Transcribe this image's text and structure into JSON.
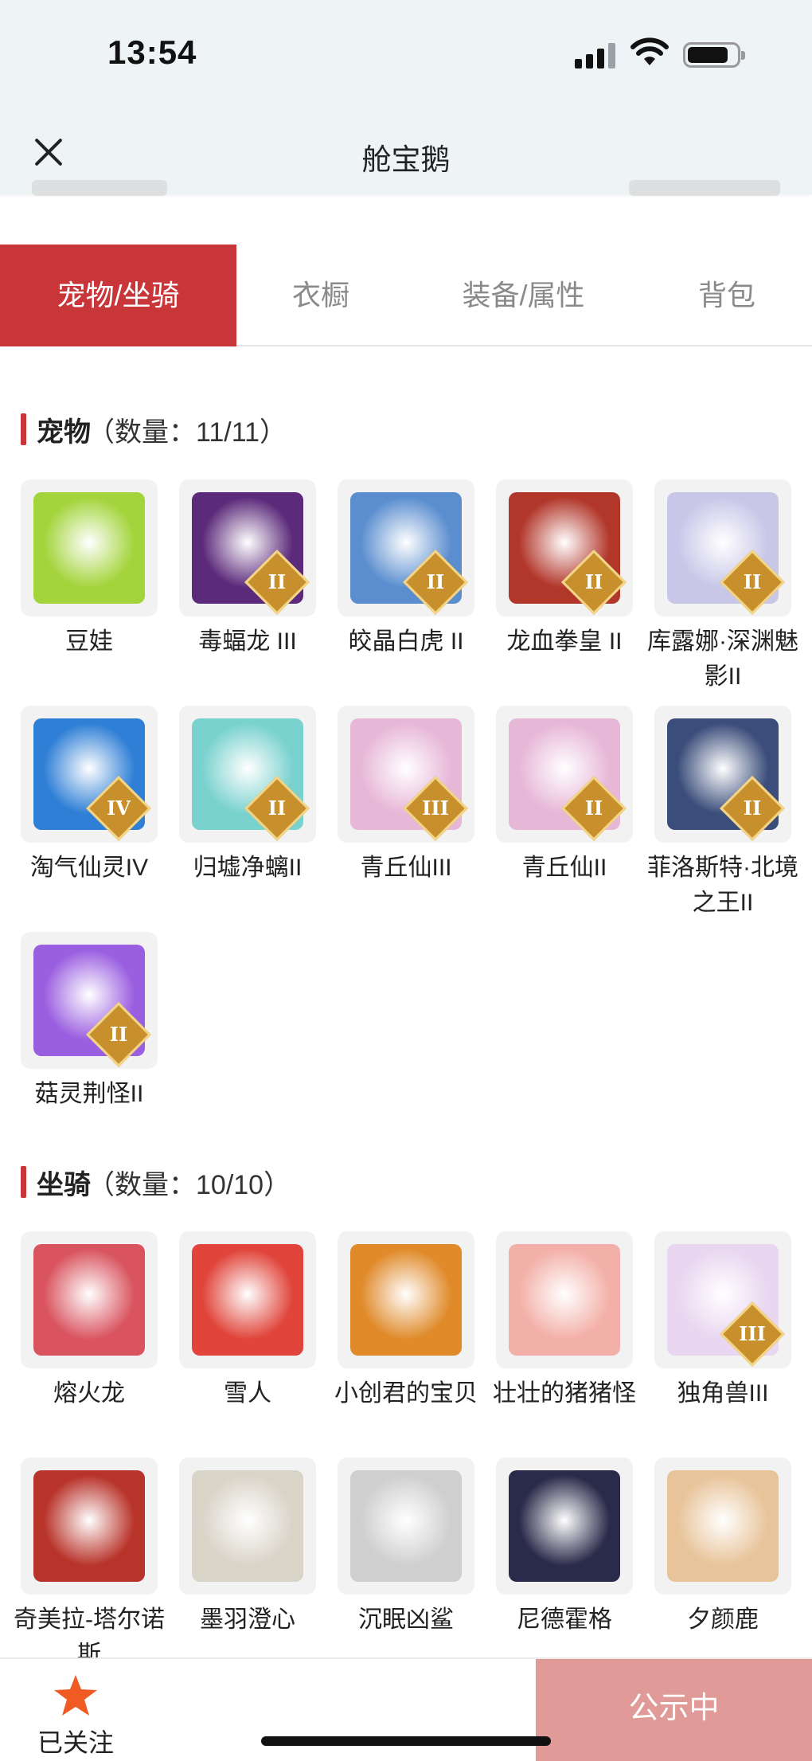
{
  "status": {
    "time": "13:54"
  },
  "header": {
    "title": "舱宝鹅"
  },
  "tabs": [
    {
      "label": "宠物/坐骑",
      "active": true
    },
    {
      "label": "衣橱",
      "active": false
    },
    {
      "label": "装备/属性",
      "active": false
    },
    {
      "label": "背包",
      "active": false
    }
  ],
  "pets": {
    "title": "宠物",
    "count": "（数量：11/11）",
    "items": [
      {
        "name": "豆娃",
        "badge": "",
        "icon": "green-bean-pet-icon",
        "color": "#a3d43b"
      },
      {
        "name": "毒蝠龙 III",
        "badge": "II",
        "icon": "dark-bat-dragon-icon",
        "color": "#5b2a7a"
      },
      {
        "name": "皎晶白虎 II",
        "badge": "II",
        "icon": "white-tiger-icon",
        "color": "#5b8ecf"
      },
      {
        "name": "龙血拳皇 II",
        "badge": "II",
        "icon": "dragon-fist-icon",
        "color": "#b2372b"
      },
      {
        "name": "库露娜·深渊魅影II",
        "badge": "II",
        "icon": "kuluna-icon",
        "color": "#c9c7e8"
      },
      {
        "name": "淘气仙灵IV",
        "badge": "IV",
        "icon": "blue-puppy-icon",
        "color": "#2f7fd6"
      },
      {
        "name": "归墟净螭II",
        "badge": "II",
        "icon": "jade-dragon-icon",
        "color": "#7ad2cf"
      },
      {
        "name": "青丘仙III",
        "badge": "III",
        "icon": "fox-fairy-icon",
        "color": "#e7b7d8"
      },
      {
        "name": "青丘仙II",
        "badge": "II",
        "icon": "fox-fairy-icon",
        "color": "#e7b7d8"
      },
      {
        "name": "菲洛斯特·北境之王II",
        "badge": "II",
        "icon": "north-king-icon",
        "color": "#3b4d7a"
      },
      {
        "name": "菇灵荆怪II",
        "badge": "II",
        "icon": "mushroom-sprite-icon",
        "color": "#9a5ee0"
      }
    ]
  },
  "mounts": {
    "title": "坐骑",
    "count": "（数量：10/10）",
    "items": [
      {
        "name": "熔火龙",
        "badge": "",
        "icon": "lava-dragon-icon",
        "color": "#d9545f"
      },
      {
        "name": "雪人",
        "badge": "",
        "icon": "snowman-icon",
        "color": "#e0443a"
      },
      {
        "name": "小创君的宝贝",
        "badge": "",
        "icon": "phoenix-bird-icon",
        "color": "#e08a2a"
      },
      {
        "name": "壮壮的猪猪怪",
        "badge": "",
        "icon": "pig-icon",
        "color": "#f3b0a8"
      },
      {
        "name": "独角兽III",
        "badge": "III",
        "icon": "unicorn-icon",
        "color": "#e9d6f0"
      },
      {
        "name": "奇美拉-塔尔诺斯",
        "badge": "",
        "icon": "chimera-icon",
        "color": "#b8332a"
      },
      {
        "name": "墨羽澄心",
        "badge": "",
        "icon": "feather-staff-icon",
        "color": "#d9d4c8"
      },
      {
        "name": "沉眠凶鲨",
        "badge": "",
        "icon": "shark-icon",
        "color": "#cfcfcf"
      },
      {
        "name": "尼德霍格",
        "badge": "",
        "icon": "nidhogg-icon",
        "color": "#2a2a4a"
      },
      {
        "name": "夕颜鹿",
        "badge": "",
        "icon": "deer-icon",
        "color": "#e8c49a"
      }
    ]
  },
  "bottom": {
    "follow_label": "已关注",
    "publish_label": "公示中"
  },
  "colors": {
    "accent": "#c8363a",
    "badge": "#c8902c",
    "publish": "#e09a97",
    "star": "#f05a23"
  }
}
